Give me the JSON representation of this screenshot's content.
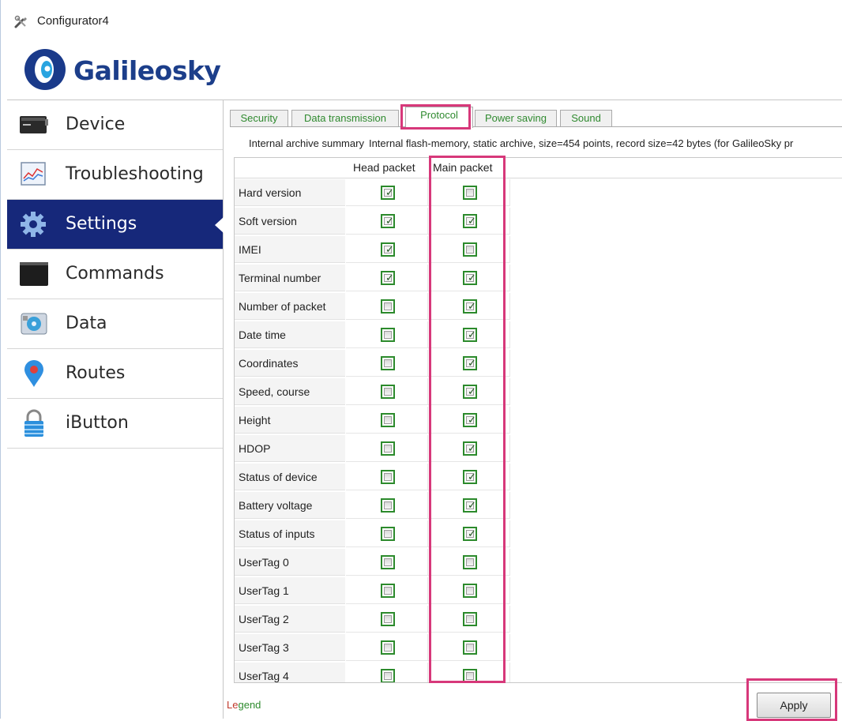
{
  "window": {
    "title": "Configurator4",
    "app_icon": "tools-icon"
  },
  "logo": {
    "brand": "Galileosky",
    "mark_icon": "galileosky-logo-icon",
    "brand_color": "#1c3e8a"
  },
  "sidebar": {
    "active_color": "#16287a",
    "items": [
      {
        "label": "Device",
        "icon": "device-icon"
      },
      {
        "label": "Troubleshooting",
        "icon": "troubleshooting-icon"
      },
      {
        "label": "Settings",
        "icon": "gear-icon",
        "active": true
      },
      {
        "label": "Commands",
        "icon": "terminal-icon"
      },
      {
        "label": "Data",
        "icon": "data-icon"
      },
      {
        "label": "Routes",
        "icon": "map-pin-icon"
      },
      {
        "label": "iButton",
        "icon": "lock-icon"
      }
    ]
  },
  "tabs": [
    {
      "label": "Security"
    },
    {
      "label": "Data transmission"
    },
    {
      "label": "Protocol",
      "active": true
    },
    {
      "label": "Power saving"
    },
    {
      "label": "Sound"
    }
  ],
  "summary": {
    "label": "Internal archive summary",
    "text": "Internal flash-memory, static archive, size=454 points, record size=42 bytes (for GalileoSky pr"
  },
  "table": {
    "headers": [
      "Head packet",
      "Main packet"
    ],
    "rows": [
      {
        "label": "Hard version",
        "head": true,
        "main": false
      },
      {
        "label": "Soft version",
        "head": true,
        "main": true
      },
      {
        "label": "IMEI",
        "head": true,
        "main": false
      },
      {
        "label": "Terminal number",
        "head": true,
        "main": true
      },
      {
        "label": "Number of packet",
        "head": false,
        "main": true
      },
      {
        "label": "Date time",
        "head": false,
        "main": true
      },
      {
        "label": "Coordinates",
        "head": false,
        "main": true
      },
      {
        "label": "Speed, course",
        "head": false,
        "main": true
      },
      {
        "label": "Height",
        "head": false,
        "main": true
      },
      {
        "label": "HDOP",
        "head": false,
        "main": true
      },
      {
        "label": "Status of device",
        "head": false,
        "main": true
      },
      {
        "label": "Battery voltage",
        "head": false,
        "main": true
      },
      {
        "label": "Status of inputs",
        "head": false,
        "main": true
      },
      {
        "label": "UserTag 0",
        "head": false,
        "main": false
      },
      {
        "label": "UserTag 1",
        "head": false,
        "main": false
      },
      {
        "label": "UserTag 2",
        "head": false,
        "main": false
      },
      {
        "label": "UserTag 3",
        "head": false,
        "main": false
      },
      {
        "label": "UserTag 4",
        "head": false,
        "main": false
      }
    ]
  },
  "legend": {
    "parts": [
      "Le",
      "ge",
      "nd"
    ]
  },
  "apply_label": "Apply",
  "colors": {
    "highlight": "#d7387a",
    "checkbox_border": "#2c8a2c",
    "tab_text": "#2f8a2f"
  }
}
